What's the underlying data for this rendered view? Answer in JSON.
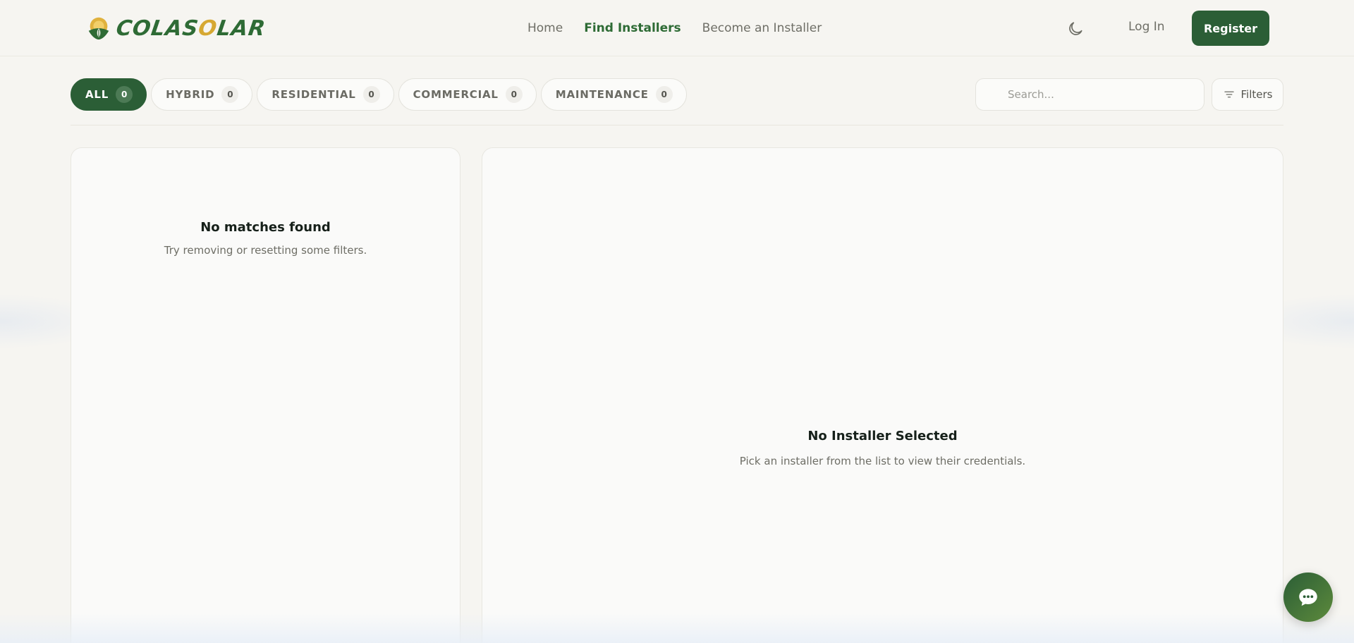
{
  "brand": {
    "name_part1": "COLAS",
    "name_accent": "O",
    "name_part2": "LAR",
    "primary_color": "#2b5e36",
    "accent_color": "#d6a832"
  },
  "nav": {
    "items": [
      {
        "label": "Home",
        "active": false
      },
      {
        "label": "Find Installers",
        "active": true
      },
      {
        "label": "Become an Installer",
        "active": false
      }
    ]
  },
  "header": {
    "theme_icon": "moon-icon",
    "login_label": "Log In",
    "register_label": "Register"
  },
  "tabs": [
    {
      "label": "ALL",
      "count": "0",
      "active": true
    },
    {
      "label": "HYBRID",
      "count": "0",
      "active": false
    },
    {
      "label": "RESIDENTIAL",
      "count": "0",
      "active": false
    },
    {
      "label": "COMMERCIAL",
      "count": "0",
      "active": false
    },
    {
      "label": "MAINTENANCE",
      "count": "0",
      "active": false
    }
  ],
  "search": {
    "placeholder": "Search...",
    "value": ""
  },
  "filters": {
    "label": "Filters",
    "icon": "filter-lines-icon"
  },
  "list_panel": {
    "empty_title": "No matches found",
    "empty_subtitle": "Try removing or resetting some filters."
  },
  "detail_panel": {
    "empty_title": "No Installer Selected",
    "empty_subtitle": "Pick an installer from the list to view their credentials."
  },
  "chat": {
    "icon": "chat-bubble-icon"
  }
}
